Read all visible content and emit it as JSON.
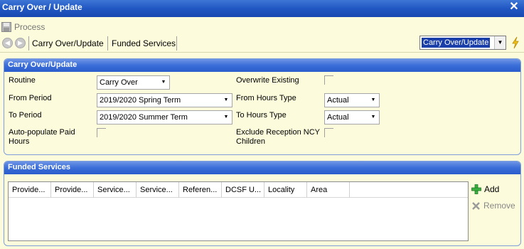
{
  "window": {
    "title": "Carry Over / Update"
  },
  "toolbar": {
    "process_label": "Process"
  },
  "breadcrumb": {
    "items": [
      "Carry Over/Update",
      "Funded Services"
    ]
  },
  "top_combo": {
    "value": "Carry Over/Update"
  },
  "carry_panel": {
    "title": "Carry Over/Update",
    "routine": {
      "label": "Routine",
      "value": "Carry Over"
    },
    "from_period": {
      "label": "From Period",
      "value": "2019/2020 Spring Term"
    },
    "to_period": {
      "label": "To Period",
      "value": "2019/2020 Summer Term"
    },
    "autopop": {
      "label_line1": "Auto-populate Paid",
      "label_line2": "Hours",
      "checked": false
    },
    "overwrite": {
      "label": "Overwrite Existing",
      "checked": false
    },
    "from_hours_type": {
      "label": "From Hours Type",
      "value": "Actual"
    },
    "to_hours_type": {
      "label": "To Hours Type",
      "value": "Actual"
    },
    "exclude_reception": {
      "label_line1": "Exclude Reception NCY",
      "label_line2": "Children",
      "checked": false
    }
  },
  "funded_panel": {
    "title": "Funded Services",
    "columns": [
      "Provide...",
      "Provide...",
      "Service...",
      "Service...",
      "Referen...",
      "DCSF U...",
      "Locality",
      "Area"
    ],
    "add_label": "Add",
    "remove_label": "Remove"
  }
}
